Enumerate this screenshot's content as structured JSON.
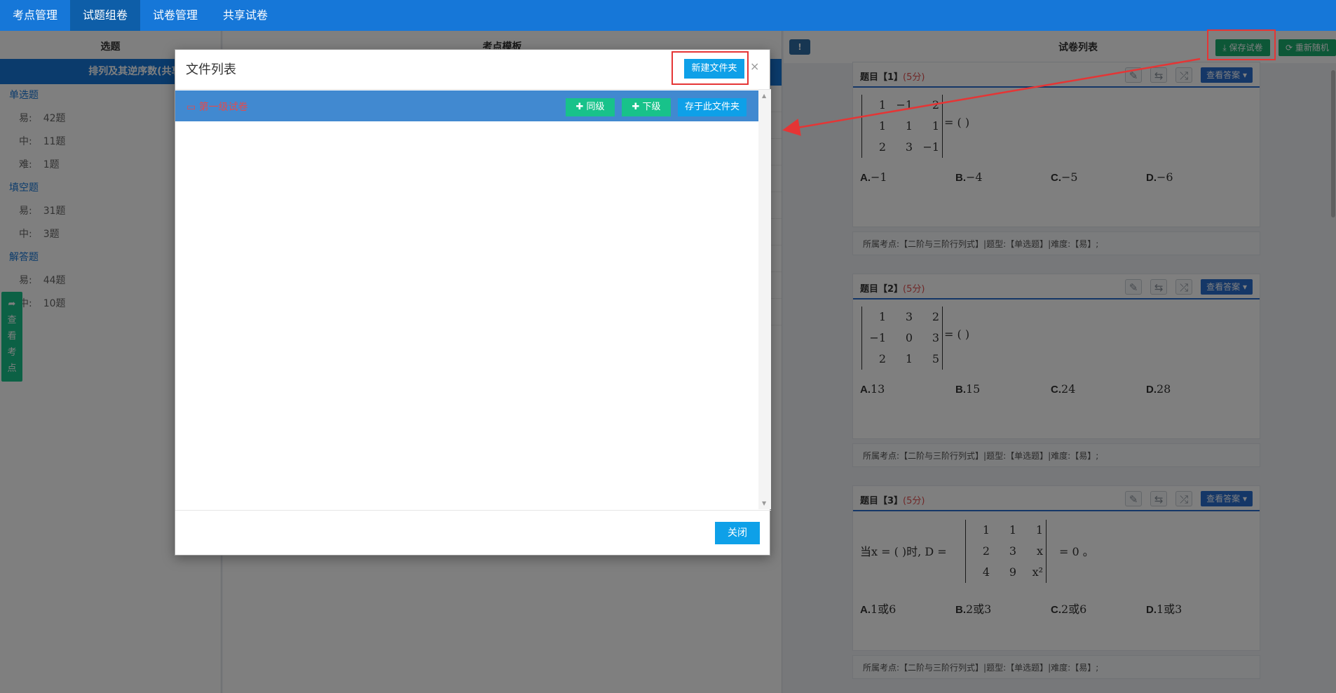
{
  "nav": {
    "items": [
      "考点管理",
      "试题组卷",
      "试卷管理",
      "共享试卷"
    ],
    "active": 1
  },
  "left": {
    "title": "选题",
    "chapter": "排列及其逆序数(共享考点)",
    "types": [
      {
        "name": "单选题",
        "levels": [
          {
            "label": "易:",
            "count": "42题"
          },
          {
            "label": "中:",
            "count": "11题"
          },
          {
            "label": "难:",
            "count": "1题"
          }
        ]
      },
      {
        "name": "填空题",
        "levels": [
          {
            "label": "易:",
            "count": "31题"
          },
          {
            "label": "中:",
            "count": "3题"
          }
        ]
      },
      {
        "name": "解答题",
        "levels": [
          {
            "label": "易:",
            "count": "44题"
          },
          {
            "label": "中:",
            "count": "10题"
          }
        ]
      }
    ],
    "side_tab": [
      "查",
      "看",
      "考",
      "点"
    ]
  },
  "middle": {
    "title": "考点模板"
  },
  "right": {
    "info": "!",
    "title": "试卷列表",
    "save_label": "保存试卷",
    "random_label": "重新随机",
    "answer_label": "查看答案",
    "questions": [
      {
        "title": "题目【1】",
        "points": "(5分)",
        "matrix": [
          [
            "1",
            "−1",
            "2"
          ],
          [
            "1",
            "1",
            "1"
          ],
          [
            "2",
            "3",
            "−1"
          ]
        ],
        "suffix": "= (    )",
        "options": [
          {
            "k": "A.",
            "v": "−1"
          },
          {
            "k": "B.",
            "v": "−4"
          },
          {
            "k": "C.",
            "v": "−5"
          },
          {
            "k": "D.",
            "v": "−6"
          }
        ],
        "meta": "所属考点:【二阶与三阶行列式】|题型:【单选题】|难度:【易】;"
      },
      {
        "title": "题目【2】",
        "points": "(5分)",
        "matrix": [
          [
            "1",
            "3",
            "2"
          ],
          [
            "−1",
            "0",
            "3"
          ],
          [
            "2",
            "1",
            "5"
          ]
        ],
        "suffix": "= (    )",
        "options": [
          {
            "k": "A.",
            "v": "13"
          },
          {
            "k": "B.",
            "v": "15"
          },
          {
            "k": "C.",
            "v": "24"
          },
          {
            "k": "D.",
            "v": "28"
          }
        ],
        "meta": "所属考点:【二阶与三阶行列式】|题型:【单选题】|难度:【易】;"
      },
      {
        "title": "题目【3】",
        "points": "(5分)",
        "prefix": "当x = (    )时, D =",
        "matrix": [
          [
            "1",
            "1",
            "1"
          ],
          [
            "2",
            "3",
            "x"
          ],
          [
            "4",
            "9",
            "x²"
          ]
        ],
        "suffix": "= 0 。",
        "options": [
          {
            "k": "A.",
            "v": "1或6"
          },
          {
            "k": "B.",
            "v": "2或3"
          },
          {
            "k": "C.",
            "v": "2或6"
          },
          {
            "k": "D.",
            "v": "1或3"
          }
        ],
        "meta": "所属考点:【二阶与三阶行列式】|题型:【单选题】|难度:【易】;"
      }
    ]
  },
  "modal": {
    "title": "文件列表",
    "new_folder": "新建文件夹",
    "close_x": "×",
    "folder": {
      "name": "第一级试卷",
      "btn_same": "同级",
      "btn_sub": "下级",
      "btn_save": "存于此文件夹"
    },
    "close": "关闭"
  }
}
